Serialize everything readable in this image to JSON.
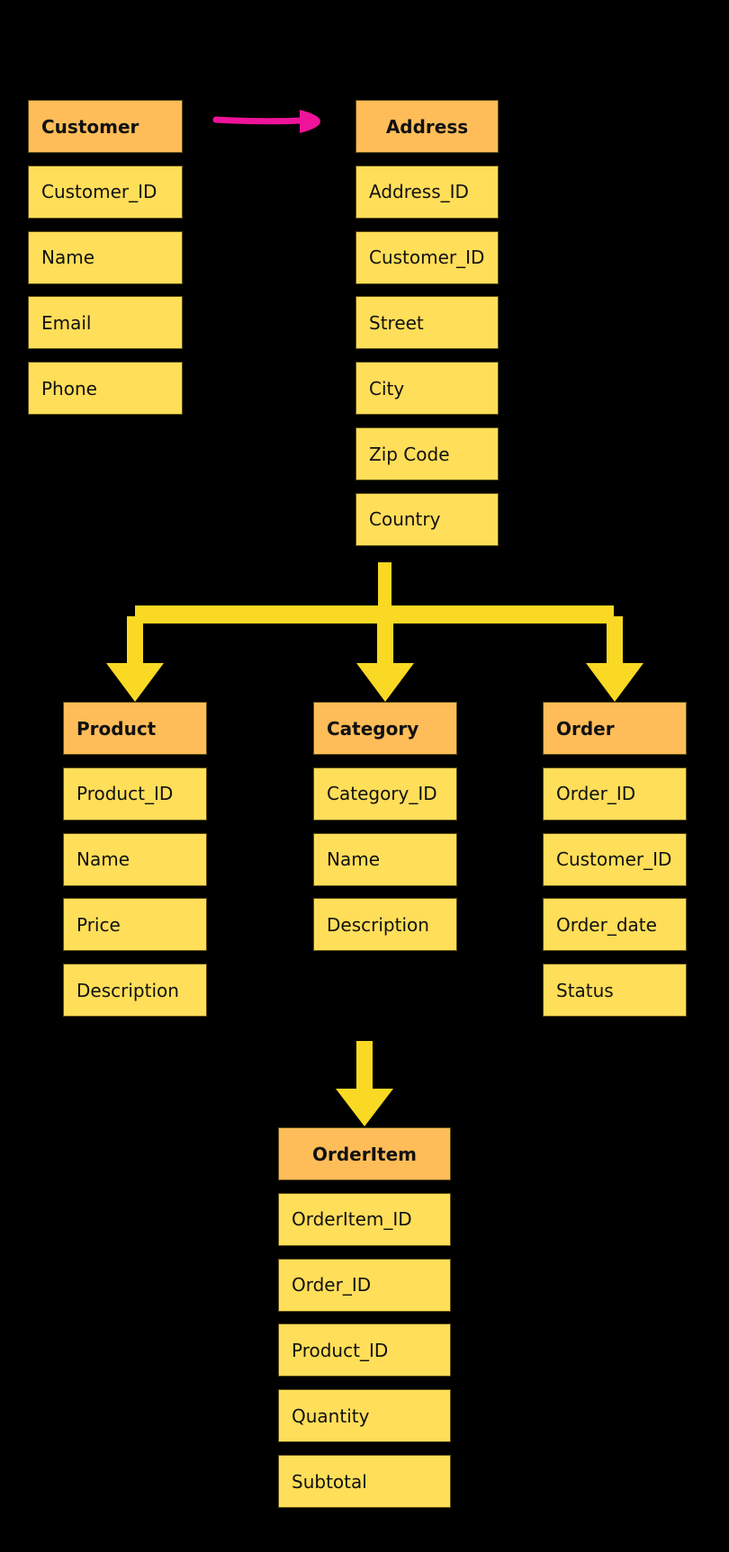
{
  "colors": {
    "header": "#FFBD59",
    "row": "#FFDE59",
    "connector": "#F9D923",
    "relation_arrow": "#F0139A",
    "background": "#000000"
  },
  "entities": [
    {
      "id": "customer",
      "title": "Customer",
      "fields": [
        "Customer_ID",
        "Name",
        "Email",
        "Phone"
      ]
    },
    {
      "id": "address",
      "title": "Address",
      "fields": [
        "Address_ID",
        "Customer_ID",
        "Street",
        "City",
        "Zip Code",
        "Country"
      ]
    },
    {
      "id": "product",
      "title": "Product",
      "fields": [
        "Product_ID",
        "Name",
        "Price",
        "Description"
      ]
    },
    {
      "id": "category",
      "title": "Category",
      "fields": [
        "Category_ID",
        "Name",
        "Description"
      ]
    },
    {
      "id": "order",
      "title": "Order",
      "fields": [
        "Order_ID",
        "Customer_ID",
        "Order_date",
        "Status"
      ]
    },
    {
      "id": "orderitem",
      "title": "OrderItem",
      "fields": [
        "OrderItem_ID",
        "Order_ID",
        "Product_ID",
        "Quantity",
        "Subtotal"
      ]
    }
  ],
  "connections": [
    {
      "from": "customer",
      "to": "address",
      "style": "pink-arrow"
    },
    {
      "from": "address",
      "to": [
        "product",
        "category",
        "order"
      ],
      "style": "yellow-branch-arrows"
    },
    {
      "from": "category",
      "to": "orderitem",
      "style": "yellow-arrow"
    }
  ]
}
